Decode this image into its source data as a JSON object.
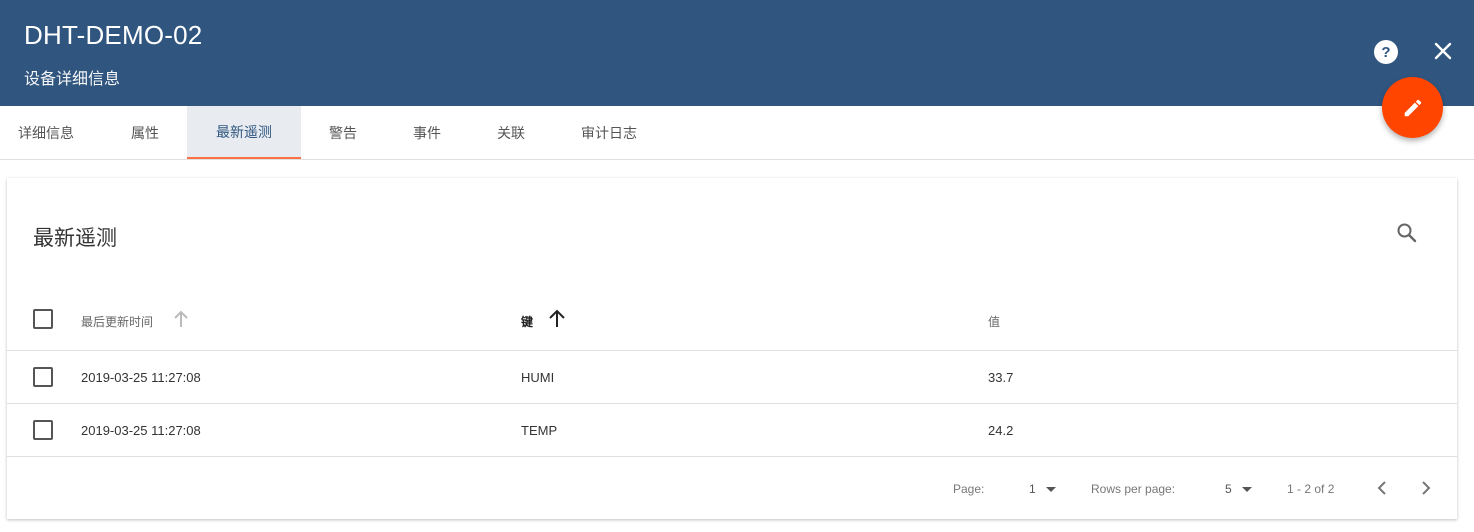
{
  "header": {
    "title": "DHT-DEMO-02",
    "subtitle": "设备详细信息"
  },
  "tabs": [
    {
      "label": "详细信息"
    },
    {
      "label": "属性"
    },
    {
      "label": "最新遥测"
    },
    {
      "label": "警告"
    },
    {
      "label": "事件"
    },
    {
      "label": "关联"
    },
    {
      "label": "审计日志"
    }
  ],
  "active_tab": "最新遥测",
  "card": {
    "title": "最新遥测",
    "columns": [
      "最后更新时间",
      "键",
      "值"
    ],
    "sort_column": "键",
    "rows": [
      {
        "time": "2019-03-25 11:27:08",
        "key": "HUMI",
        "value": "33.7"
      },
      {
        "time": "2019-03-25 11:27:08",
        "key": "TEMP",
        "value": "24.2"
      }
    ],
    "footer": {
      "page_label": "Page:",
      "page_value": "1",
      "rows_label": "Rows per page:",
      "rows_value": "5",
      "range": "1 - 2 of 2"
    }
  },
  "colors": {
    "header": "#305680",
    "accent": "#ff4500",
    "tab_indicator": "#ff7043"
  },
  "icons": [
    "help-icon",
    "close-icon",
    "edit-icon",
    "search-icon",
    "sort-arrow-icon",
    "chevron-left-icon",
    "chevron-right-icon",
    "dropdown-icon"
  ]
}
